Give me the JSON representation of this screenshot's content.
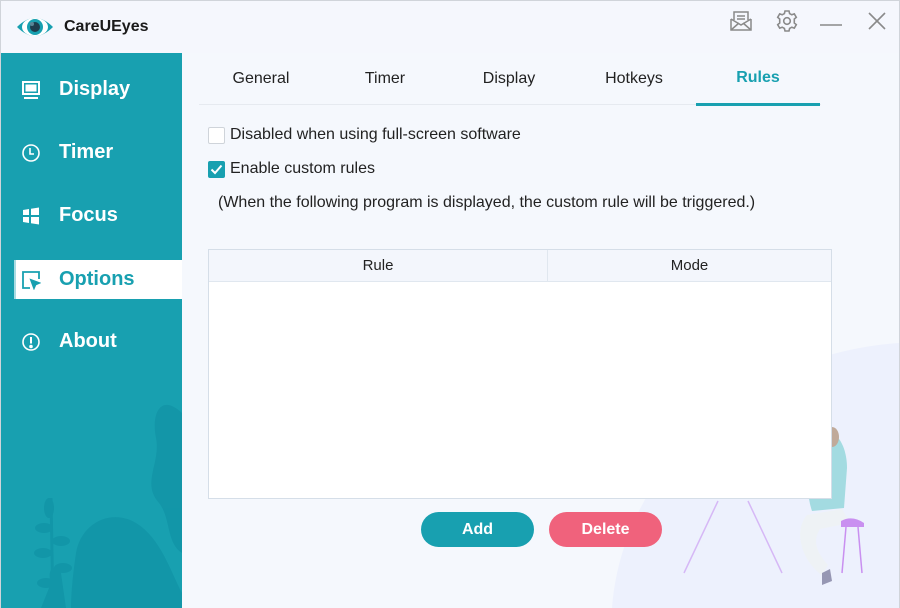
{
  "app": {
    "title": "CareUEyes",
    "titlebar_buttons": [
      {
        "name": "feedback",
        "icon": "mail-open-icon"
      },
      {
        "name": "settings",
        "icon": "gear-icon"
      },
      {
        "name": "minimize",
        "icon": "minimize-icon"
      },
      {
        "name": "close",
        "icon": "close-icon"
      }
    ]
  },
  "colors": {
    "accent": "#18a0b0",
    "danger": "#f0627c",
    "background": "#f5f8fd"
  },
  "sidebar": {
    "items": [
      {
        "label": "Display",
        "icon": "monitor-icon",
        "active": false
      },
      {
        "label": "Timer",
        "icon": "clock-icon",
        "active": false
      },
      {
        "label": "Focus",
        "icon": "windows-icon",
        "active": false
      },
      {
        "label": "Options",
        "icon": "cursor-select-icon",
        "active": true
      },
      {
        "label": "About",
        "icon": "info-exclamation-icon",
        "active": false
      }
    ]
  },
  "tabs": [
    {
      "label": "General",
      "active": false
    },
    {
      "label": "Timer",
      "active": false
    },
    {
      "label": "Display",
      "active": false
    },
    {
      "label": "Hotkeys",
      "active": false
    },
    {
      "label": "Rules",
      "active": true
    }
  ],
  "rules": {
    "options": [
      {
        "label": "Disabled when using full-screen software",
        "checked": false
      },
      {
        "label": "Enable custom rules",
        "checked": true
      }
    ],
    "note": "(When the following program is displayed, the custom rule will be triggered.)",
    "table": {
      "columns": [
        "Rule",
        "Mode"
      ],
      "rows": []
    },
    "add_label": "Add",
    "delete_label": "Delete"
  }
}
